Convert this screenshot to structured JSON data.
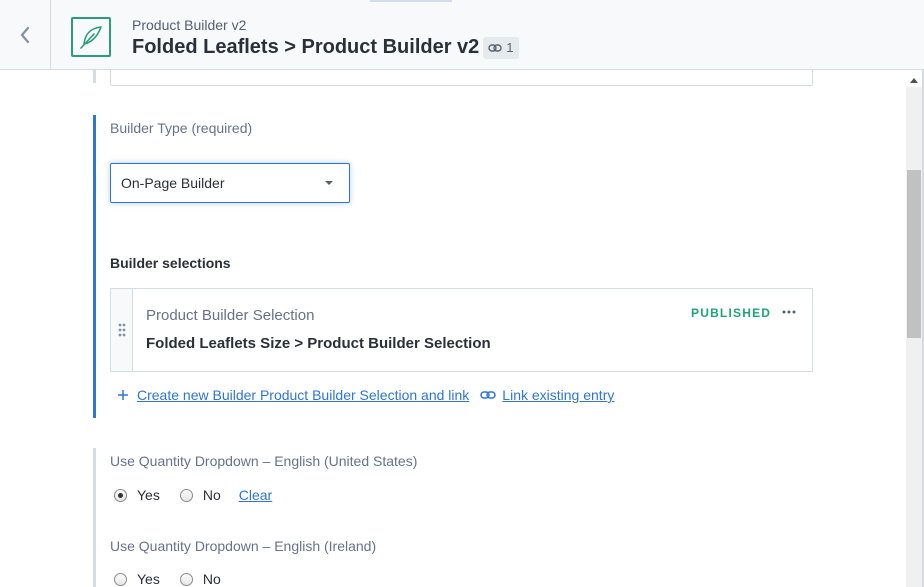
{
  "header": {
    "subtitle": "Product Builder v2",
    "title": "Folded Leaflets > Product Builder v2",
    "reference_count": "1",
    "icons": {
      "back": "chevron-left-icon",
      "entry": "feather-icon",
      "reference": "link-icon"
    },
    "accent_color": "#2a9d7c"
  },
  "builder_type": {
    "label": "Builder Type (required)",
    "selected": "On-Page Builder"
  },
  "builder_selections": {
    "heading": "Builder selections",
    "card": {
      "content_type": "Product Builder Selection",
      "title": "Folded Leaflets Size > Product Builder Selection",
      "status": "PUBLISHED",
      "status_color": "#1da672"
    },
    "create_link": "Create new Builder Product Builder Selection and link",
    "link_existing": "Link existing entry"
  },
  "quantity_us": {
    "label": "Use Quantity Dropdown – English (United States)",
    "yes": "Yes",
    "no": "No",
    "clear": "Clear",
    "selected": "Yes"
  },
  "quantity_ie": {
    "label": "Use Quantity Dropdown – English (Ireland)",
    "yes": "Yes",
    "no": "No"
  },
  "colors": {
    "link": "#2e75d4",
    "active_section": "#2e75d4"
  }
}
